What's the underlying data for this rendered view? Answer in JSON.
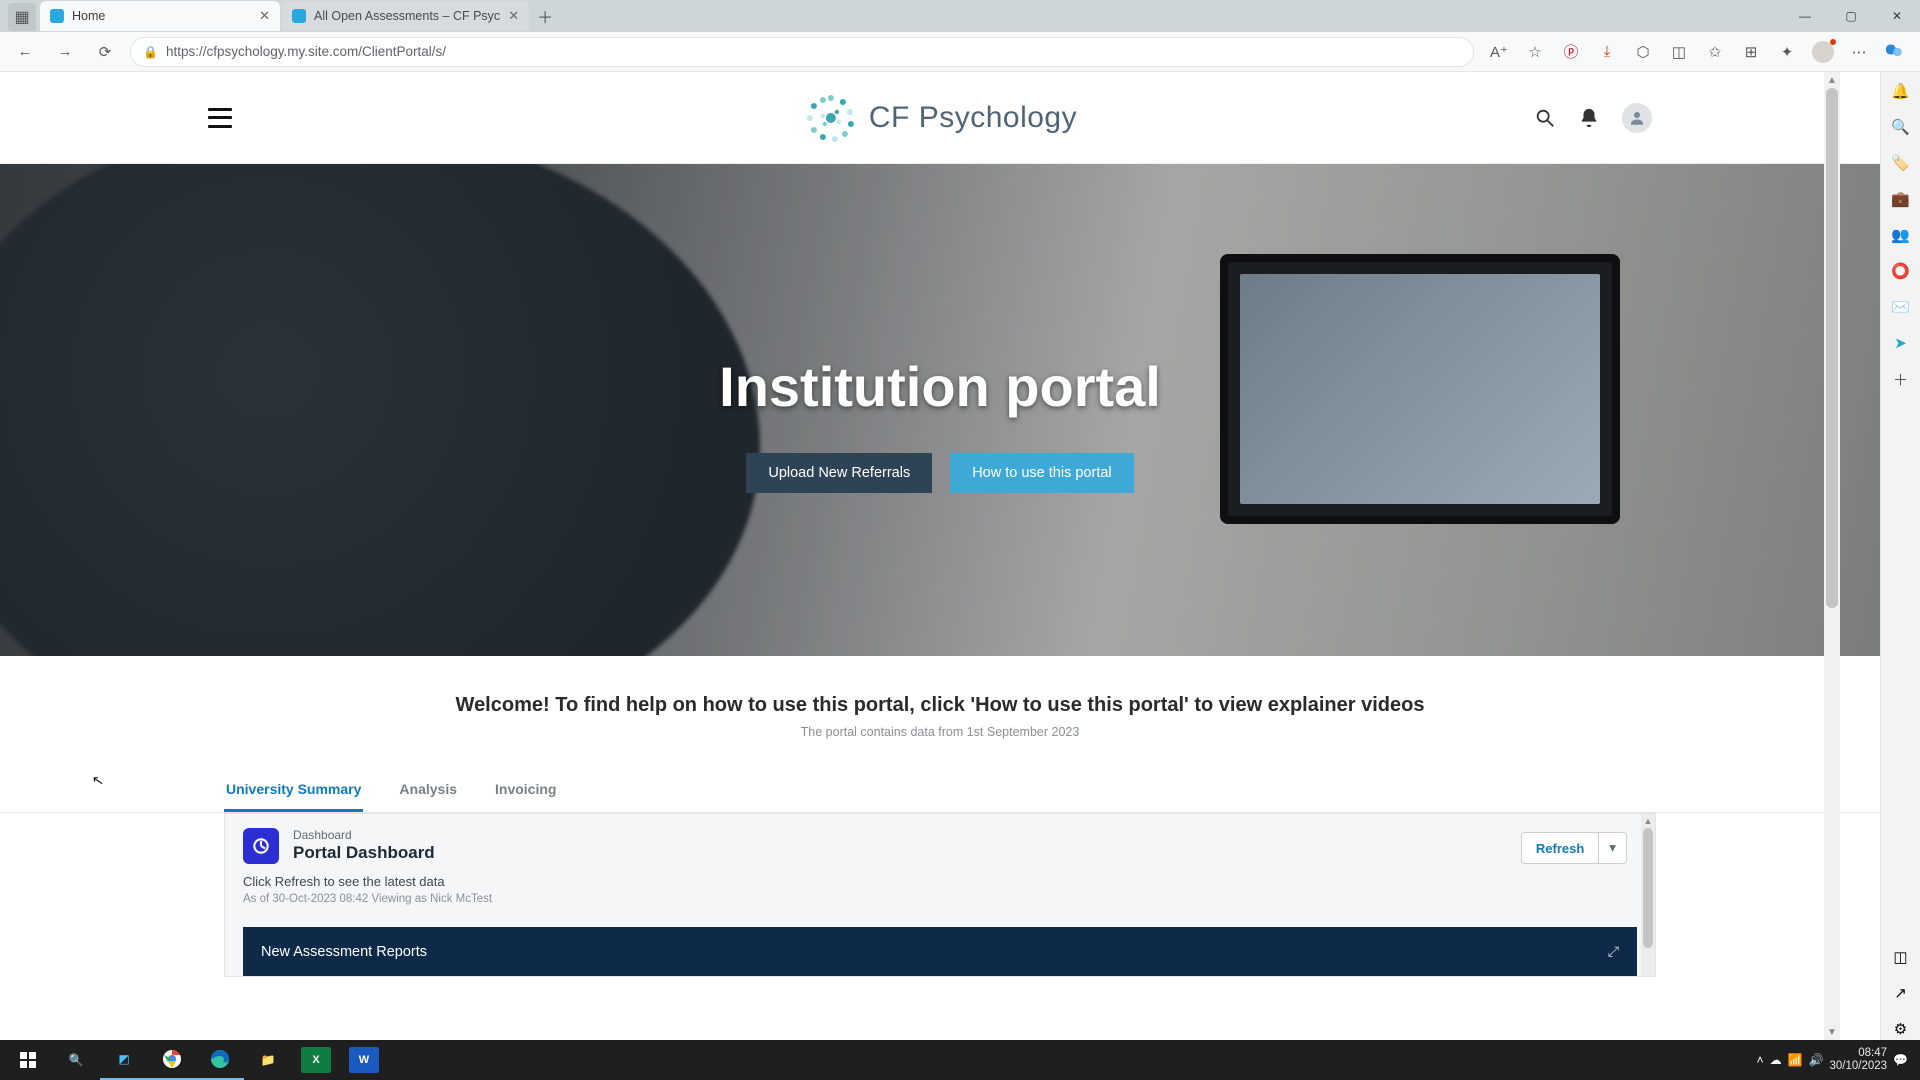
{
  "browser": {
    "tabs": [
      {
        "title": "Home",
        "favicon": "#2aa7df"
      },
      {
        "title": "All Open Assessments – CF Psyc",
        "favicon": "#2aa7df"
      }
    ],
    "url": "https://cfpsychology.my.site.com/ClientPortal/s/",
    "win": {
      "min": "—",
      "max": "▢",
      "close": "✕"
    }
  },
  "brand": {
    "text": "CF Psychology"
  },
  "hero": {
    "title": "Institution portal",
    "btn_upload": "Upload New Referrals",
    "btn_howto": "How to use this portal"
  },
  "welcome": {
    "headline": "Welcome! To find help on how to use this portal, click 'How to use this portal' to view explainer videos",
    "sub": "The portal contains data from 1st September 2023"
  },
  "tabs": {
    "t1": "University Summary",
    "t2": "Analysis",
    "t3": "Invoicing"
  },
  "dashboard": {
    "eyebrow": "Dashboard",
    "title": "Portal Dashboard",
    "sub": "Click Refresh to see the latest data",
    "stamp": "As of 30-Oct-2023 08:42 Viewing as Nick McTest",
    "refresh": "Refresh",
    "report_bar": "New Assessment Reports"
  },
  "edge_icons": [
    "bell",
    "search",
    "tag",
    "briefcase",
    "people",
    "circle",
    "mail",
    "send",
    "plus"
  ],
  "taskbar": {
    "time": "08:47",
    "date": "30/10/2023"
  }
}
